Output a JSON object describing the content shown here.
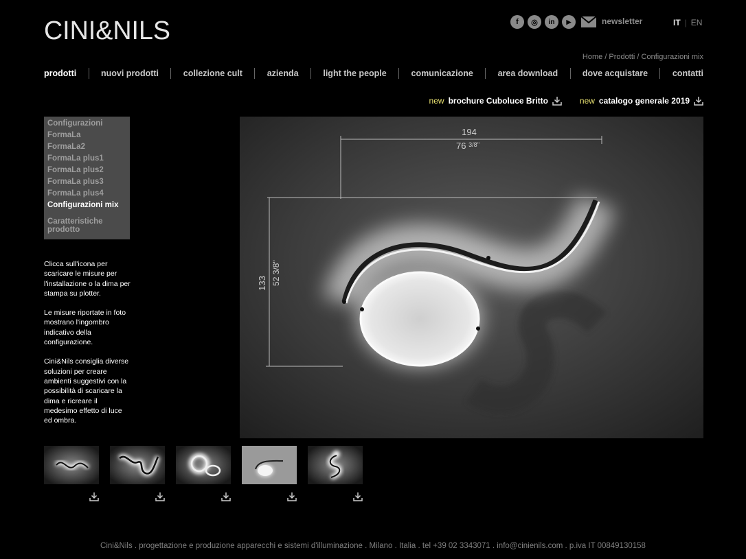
{
  "header": {
    "brand": "CINI&NILS",
    "social": [
      {
        "icon": "facebook-icon",
        "glyph": "f"
      },
      {
        "icon": "instagram-icon",
        "glyph": "◎"
      },
      {
        "icon": "linkedin-icon",
        "glyph": "in"
      },
      {
        "icon": "youtube-icon",
        "glyph": "▶"
      }
    ],
    "newsletter_label": "newsletter",
    "languages": {
      "it": "IT",
      "sep": "|",
      "en": "EN"
    }
  },
  "breadcrumb": "Home / Prodotti / Configurazioni mix",
  "nav": {
    "items": [
      "prodotti",
      "nuovi prodotti",
      "collezione cult",
      "azienda",
      "light the people",
      "comunicazione",
      "area download",
      "dove acquistare",
      "contatti"
    ]
  },
  "promo": {
    "new1": "new",
    "label1": "brochure Cuboluce Britto",
    "new2": "new",
    "label2": "catalogo generale 2019"
  },
  "sidebar": {
    "items": [
      "Configurazioni",
      "FormaLa",
      "FormaLa2",
      "FormaLa plus1",
      "FormaLa plus2",
      "FormaLa plus3",
      "FormaLa plus4",
      "Configurazioni mix"
    ],
    "extra": "Caratteristiche prodotto"
  },
  "description": {
    "p1": "Clicca sull'icona per scaricare le misure per l'installazione o la dima per stampa su plotter.",
    "p2": "Le misure riportate in foto mostrano l'ingombro indicativo della configurazione.",
    "p3": "Cini&Nils consiglia diverse soluzioni per creare ambienti suggestivi con la possibilità di scaricare la dima e ricreare il medesimo effetto di luce ed ombra."
  },
  "photo": {
    "width_cm": "194",
    "width_in": "76",
    "width_in_frac": "3/8''",
    "height_cm": "133",
    "height_in": "52 3/8''"
  },
  "footer": "Cini&Nils . progettazione e produzione apparecchi e sistemi d'illuminazione . Milano . Italia . tel +39 02 3343071 . info@cinienils.com . p.iva IT 00849130158",
  "colors": {
    "accent_new": "#e7e070",
    "menu_bg": "#4b4b4b"
  }
}
